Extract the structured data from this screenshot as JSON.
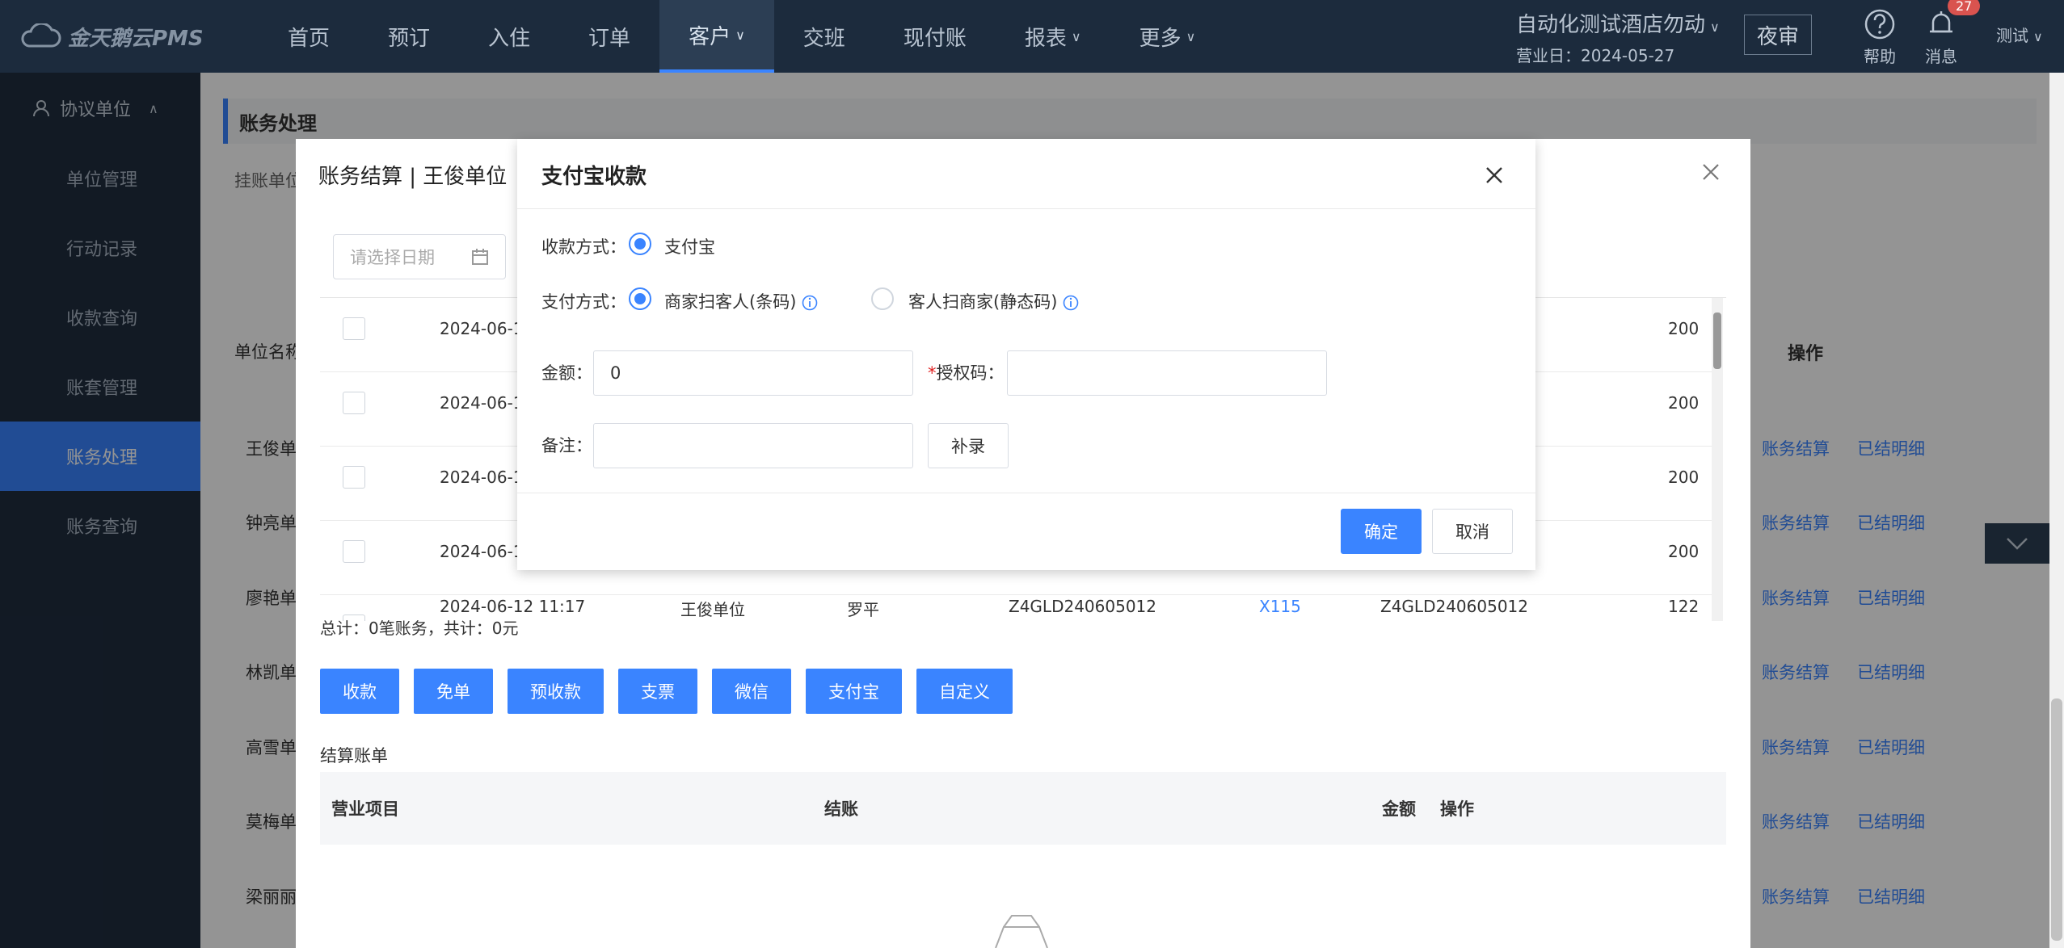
{
  "topbar": {
    "logo": "金天鹅云PMS",
    "nav": [
      {
        "label": "首页",
        "chevron": false
      },
      {
        "label": "预订",
        "chevron": false
      },
      {
        "label": "入住",
        "chevron": false
      },
      {
        "label": "订单",
        "chevron": false
      },
      {
        "label": "客户",
        "chevron": true,
        "active": true
      },
      {
        "label": "交班",
        "chevron": false
      },
      {
        "label": "现付账",
        "chevron": false
      },
      {
        "label": "报表",
        "chevron": true
      },
      {
        "label": "更多",
        "chevron": true
      }
    ],
    "hotel_name": "自动化测试酒店勿动",
    "business_date": "营业日：2024-05-27",
    "night_audit": "夜审",
    "help": "帮助",
    "messages": "消息",
    "message_count": "27",
    "user": "测试"
  },
  "sidebar": {
    "header": "协议单位",
    "items": [
      "单位管理",
      "行动记录",
      "收款查询",
      "账套管理",
      "账务处理",
      "账务查询"
    ],
    "active_index": 4
  },
  "content": {
    "breadcrumb": "账务处理",
    "filter_label": "挂账单位",
    "unit_col": "单位名称",
    "op_col": "操作",
    "units": [
      "王俊单",
      "钟亮单",
      "廖艳单",
      "林凯单",
      "高雪单",
      "莫梅单",
      "梁丽丽"
    ],
    "op_settle": "账务结算",
    "op_detail": "已结明细"
  },
  "modal1": {
    "title": "账务结算 | 王俊单位",
    "date_placeholder": "请选择日期",
    "rows": [
      {
        "date": "2024-06-12",
        "unit": "",
        "name": "",
        "no": "",
        "room": "",
        "no2": "",
        "amount": "200"
      },
      {
        "date": "2024-06-12",
        "unit": "",
        "name": "",
        "no": "",
        "room": "",
        "no2": "",
        "amount": "200"
      },
      {
        "date": "2024-06-12",
        "unit": "",
        "name": "",
        "no": "",
        "room": "",
        "no2": "",
        "amount": "200"
      },
      {
        "date": "2024-06-12",
        "unit": "",
        "name": "",
        "no": "",
        "room": "",
        "no2": "",
        "amount": "200"
      },
      {
        "date": "2024-06-12 11:17",
        "unit": "王俊单位",
        "name": "罗平",
        "no": "Z4GLD240605012",
        "room": "X115",
        "no2": "Z4GLD240605012",
        "amount": "122"
      }
    ],
    "total": "总计：0笔账务，共计：0元",
    "buttons": [
      "收款",
      "免单",
      "预收款",
      "支票",
      "微信",
      "支付宝",
      "自定义"
    ],
    "settle_title": "结算账单",
    "settle_cols": {
      "item": "营业项目",
      "checkout": "结账",
      "amount": "金额",
      "op": "操作"
    }
  },
  "modal2": {
    "title": "支付宝收款",
    "method_label": "收款方式：",
    "method_option": "支付宝",
    "pay_label": "支付方式：",
    "pay_option1": "商家扫客人(条码)",
    "pay_option2": "客人扫商家(静态码)",
    "amount_label": "金额：",
    "amount_value": "0",
    "auth_label": "授权码：",
    "auth_value": "",
    "remark_label": "备注：",
    "remark_value": "",
    "supplement": "补录",
    "confirm": "确定",
    "cancel": "取消"
  },
  "colors": {
    "accent": "#3a84ff",
    "topbar": "#1c2b3d",
    "required": "#e02020"
  }
}
